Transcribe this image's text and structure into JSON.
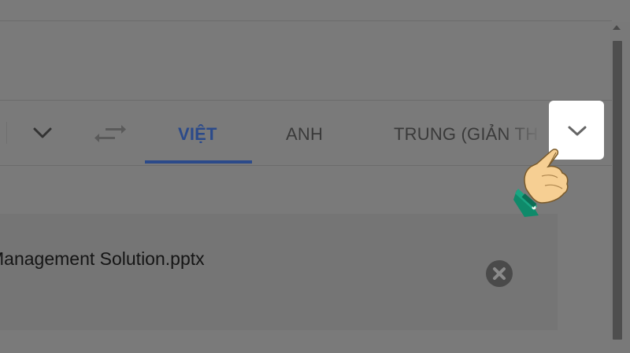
{
  "language_bar": {
    "tabs": [
      {
        "label": "VIỆT",
        "active": true
      },
      {
        "label": "ANH",
        "active": false
      },
      {
        "label": "TRUNG (GIẢN TH",
        "active": false
      }
    ],
    "source_dropdown_icon": "chevron-down-icon",
    "swap_icon": "swap-arrows-icon",
    "more_languages_icon": "chevron-down-icon"
  },
  "file": {
    "name": "Management Solution.pptx",
    "remove_icon": "close-circle-icon"
  },
  "overlay": {
    "pointer_icon": "pointing-hand-icon"
  },
  "colors": {
    "overlay_bg": "#7a7a7a",
    "active_tab": "#2b4a8a",
    "text_dark": "#151515",
    "highlight": "#ffffff"
  }
}
